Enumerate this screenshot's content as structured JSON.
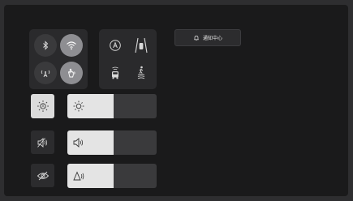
{
  "notification_center": {
    "label": "通知中心",
    "icon": "bell-icon"
  },
  "connectivity_tiles": [
    {
      "name": "bluetooth",
      "icon": "bluetooth-icon",
      "active": false
    },
    {
      "name": "wifi",
      "icon": "wifi-icon",
      "active": true
    },
    {
      "name": "hotspot",
      "icon": "hotspot-icon",
      "active": false
    },
    {
      "name": "hand-gesture",
      "icon": "hand-gesture-icon",
      "active": true
    }
  ],
  "drive_tiles": [
    {
      "name": "auto-hold",
      "icon": "auto-hold-icon"
    },
    {
      "name": "lane-keep",
      "icon": "lane-keep-icon"
    },
    {
      "name": "front-sensor",
      "icon": "car-front-sensor-icon"
    },
    {
      "name": "pedestrian-warning",
      "icon": "pedestrian-warning-icon"
    }
  ],
  "controls": {
    "brightness": {
      "toggle_icon": "auto-brightness-icon",
      "slider_icon": "sun-icon",
      "level": 0.52
    },
    "volume": {
      "toggle_icon": "volume-mute-icon",
      "slider_icon": "volume-icon",
      "level": 0.52
    },
    "privacy": {
      "toggle_icon": "eye-off-icon",
      "slider_icon": "alert-tone-icon",
      "level": 0.52
    }
  },
  "colors": {
    "screen_bg": "#1a1a1b",
    "panel_bg": "#2a2a2c",
    "active_tile": "#8e8e92",
    "slider_fill": "#e4e4e4",
    "slider_track": "#3a3a3c"
  }
}
